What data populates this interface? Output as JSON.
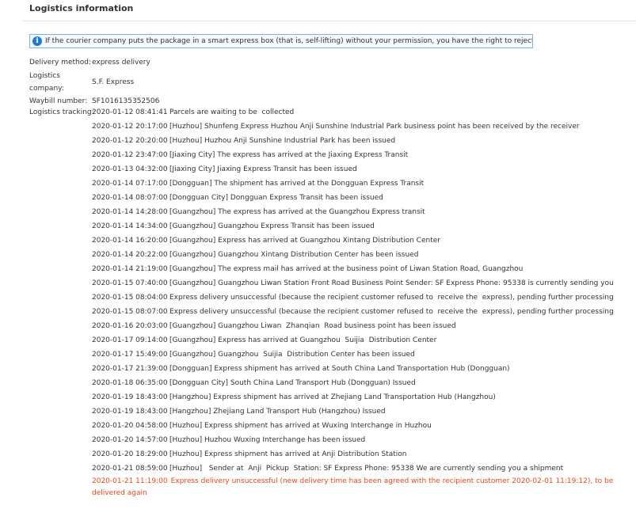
{
  "header": {
    "title": "Logistics information"
  },
  "notice": {
    "text": "If the courier company puts the package in a smart express box (that is, self-lifting) without your permission, you have the right to reject it.",
    "link": "[?]"
  },
  "details": {
    "delivery_method_label": "Delivery method:",
    "delivery_method_value": "express delivery",
    "company_label_line1": "Logistics",
    "company_label_line2": "company:",
    "company_value": "S.F. Express",
    "waybill_label": "Waybill number:",
    "waybill_value": "SF1016135352506",
    "tracking_label": "Logistics tracking:"
  },
  "tracking": [
    {
      "time": "2020-01-12 08:41:41",
      "desc": "Parcels are waiting to be  collected"
    },
    {
      "time": "2020-01-12 20:17:00",
      "desc": "[Huzhou] Shunfeng Express Huzhou Anji Sunshine Industrial Park business point has been received by the receiver"
    },
    {
      "time": "2020-01-12 20:20:00",
      "desc": "[Huzhou] Huzhou Anji Sunshine Industrial Park has been issued"
    },
    {
      "time": "2020-01-12 23:47:00",
      "desc": "[Jiaxing City] The express has arrived at the Jiaxing Express Transit"
    },
    {
      "time": "2020-01-13 04:32:00",
      "desc": "[Jiaxing City] Jiaxing Express Transit has been issued"
    },
    {
      "time": "2020-01-14 07:17:00",
      "desc": "[Dongguan] The shipment has arrived at the Dongguan Express Transit"
    },
    {
      "time": "2020-01-14 08:07:00",
      "desc": "[Dongguan City] Dongguan Express Transit has been issued"
    },
    {
      "time": "2020-01-14 14:28:00",
      "desc": "[Guangzhou] The express has arrived at the Guangzhou Express transit"
    },
    {
      "time": "2020-01-14 14:34:00",
      "desc": "[Guangzhou] Guangzhou Express Transit has been issued"
    },
    {
      "time": "2020-01-14 16:20:00",
      "desc": "[Guangzhou] Express has arrived at Guangzhou Xintang Distribution Center"
    },
    {
      "time": "2020-01-14 20:22:00",
      "desc": "[Guangzhou] Guangzhou Xintang Distribution Center has been issued"
    },
    {
      "time": "2020-01-14 21:19:00",
      "desc": "[Guangzhou] The express mail has arrived at the business point of Liwan Station Road, Guangzhou"
    },
    {
      "time": "2020-01-15 07:40:00",
      "desc": "[Guangzhou] Guangzhou Liwan Station Front Road Business Point Sender: SF Express Phone: 95338 is currently sending you"
    },
    {
      "time": "2020-01-15 08:04:00",
      "desc": "Express delivery unsuccessful (because the recipient customer refused to  receive the  express), pending further processing"
    },
    {
      "time": "2020-01-15 08:07:00",
      "desc": "Express delivery unsuccessful (because the recipient customer refused to  receive the  express), pending further processing"
    },
    {
      "time": "2020-01-16 20:03:00",
      "desc": "[Guangzhou] Guangzhou Liwan  Zhanqian  Road business point has been issued"
    },
    {
      "time": "2020-01-17 09:14:00",
      "desc": "[Guangzhou] Express has arrived at Guangzhou  Suijia  Distribution Center"
    },
    {
      "time": "2020-01-17 15:49:00",
      "desc": "[Guangzhou] Guangzhou  Suijia  Distribution Center has been issued"
    },
    {
      "time": "2020-01-17 21:39:00",
      "desc": "[Dongguan] Express shipment has arrived at South China Land Transportation Hub (Dongguan)"
    },
    {
      "time": "2020-01-18 06:35:00",
      "desc": "[Dongguan City] South China Land Transport Hub (Dongguan) Issued"
    },
    {
      "time": "2020-01-19 18:43:00",
      "desc": "[Hangzhou] Express shipment has arrived at Zhejiang Land Transportation Hub (Hangzhou)"
    },
    {
      "time": "2020-01-19 18:43:00",
      "desc": "[Hangzhou] Zhejiang Land Transport Hub (Hangzhou) Issued"
    },
    {
      "time": "2020-01-20 04:58:00",
      "desc": "[Huzhou] Express shipment has arrived at Wuxing Interchange in Huzhou"
    },
    {
      "time": "2020-01-20 14:57:00",
      "desc": "[Huzhou] Huzhou Wuxing Interchange has been issued"
    },
    {
      "time": "2020-01-20 18:29:00",
      "desc": "[Huzhou] Express shipment has arrived at Anji Distribution Station"
    },
    {
      "time": "2020-01-21 08:59:00",
      "desc": "[Huzhou]   Sender at  Anji  Pickup  Station: SF Express Phone: 95338 We are currently sending you a shipment"
    },
    {
      "time": "2020-01-21 11:19:00",
      "desc": "Express delivery unsuccessful (new delivery time has been agreed with the recipient customer 2020-02-01 11:19:12), to be delivered again",
      "highlight": true
    }
  ],
  "colors": {
    "highlight": "#e8491c",
    "notice_border": "#7ab6e5",
    "info_icon": "#1e7bd3",
    "link": "#3a6ecf"
  }
}
